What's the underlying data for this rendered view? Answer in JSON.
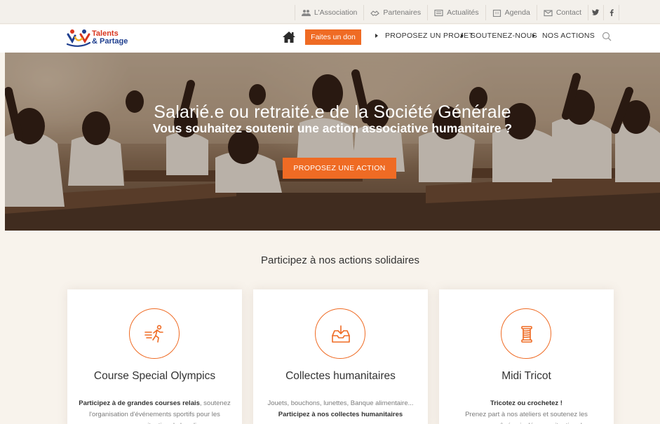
{
  "topbar": {
    "items": [
      {
        "label": "L'Association",
        "icon": "users-icon"
      },
      {
        "label": "Partenaires",
        "icon": "handshake-icon"
      },
      {
        "label": "Actualités",
        "icon": "newspaper-icon"
      },
      {
        "label": "Agenda",
        "icon": "calendar-icon"
      },
      {
        "label": "Contact",
        "icon": "envelope-icon"
      }
    ],
    "social": {
      "twitter": "y",
      "facebook": "f"
    }
  },
  "nav": {
    "logo_line1": "Talents",
    "logo_line2": "& Partage",
    "donate_label": "Faites un don",
    "items": [
      "PROPOSEZ UN PROJET",
      "SOUTENEZ-NOUS",
      "NOS ACTIONS"
    ]
  },
  "hero": {
    "line1": "Salarié.e ou retraité.e de la Société Générale",
    "line2": "Vous souhaitez soutenir une action associative humanitaire ?",
    "cta_label": "PROPOSEZ UNE ACTION"
  },
  "section": {
    "title": "Participez à nos actions solidaires"
  },
  "cards": [
    {
      "title": "Course Special Olympics",
      "icon": "runner-icon",
      "text_strong": "Participez à de grandes courses relais",
      "text_rest": ", soutenez l'organisation d'événements sportifs pour les personnes en situation de handicap"
    },
    {
      "title": "Collectes humanitaires",
      "icon": "inbox-download-icon",
      "text_pre": "Jouets, bouchons, lunettes, Banque alimentaire...",
      "text_strong": "Participez à nos collectes humanitaires"
    },
    {
      "title": "Midi Tricot",
      "icon": "yarn-spool-icon",
      "text_strong": "Tricotez ou crochetez !",
      "text_rest": "Prenez part à nos ateliers et soutenez les personnes âgées isolées en situation de"
    }
  ],
  "colors": {
    "accent": "#ef6b24",
    "background": "#f8f3ec",
    "logo_red": "#d9361e",
    "logo_blue": "#1f3f8f"
  }
}
